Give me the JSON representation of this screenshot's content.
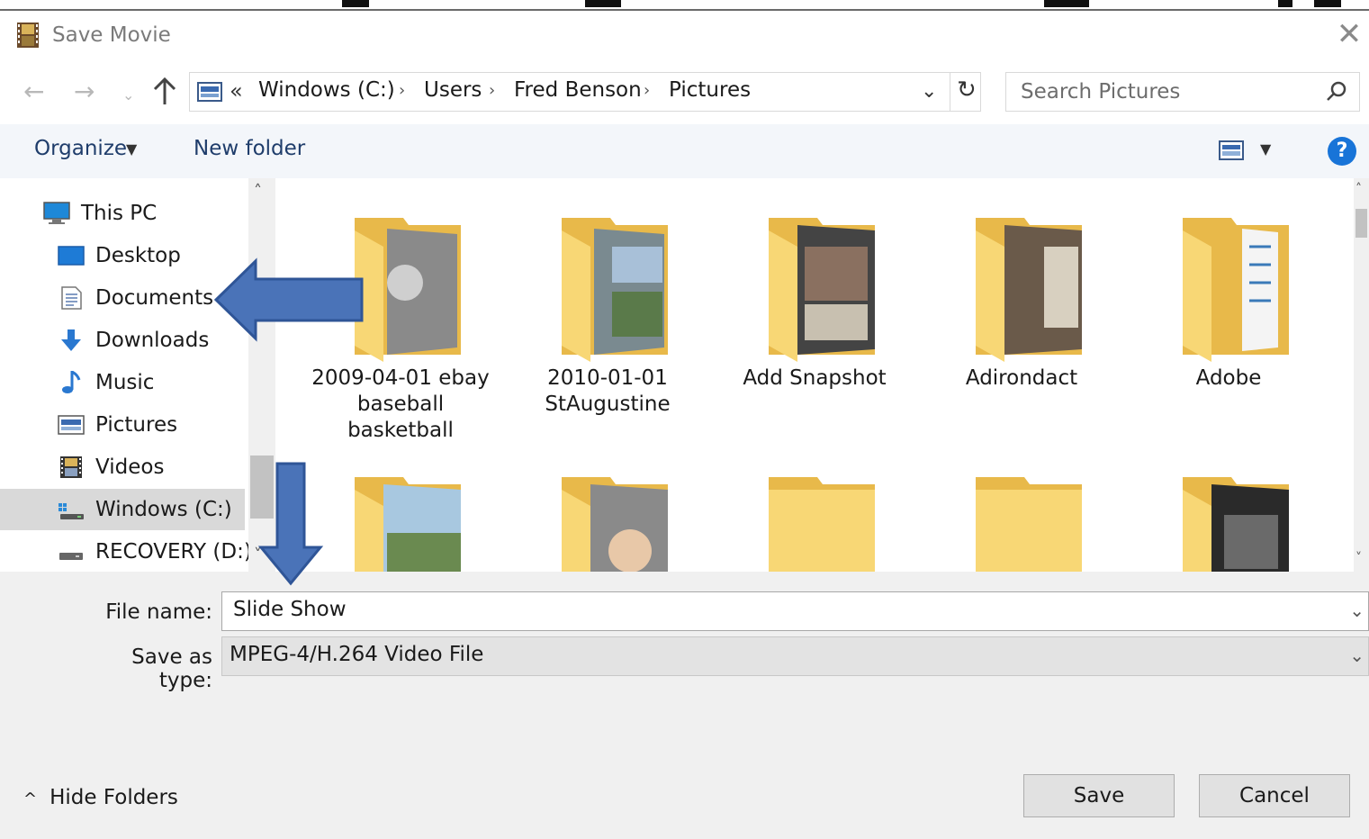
{
  "window": {
    "title": "Save Movie"
  },
  "address": {
    "chevron": "«",
    "crumbs": [
      "Windows (C:)",
      "Users",
      "Fred Benson",
      "Pictures"
    ],
    "separator": "›"
  },
  "search": {
    "placeholder": "Search Pictures"
  },
  "toolbar": {
    "organize": "Organize",
    "new_folder": "New folder",
    "help": "?"
  },
  "nav": {
    "items": [
      {
        "label": "This PC",
        "icon": "computer-icon"
      },
      {
        "label": "Desktop",
        "icon": "desktop-icon"
      },
      {
        "label": "Documents",
        "icon": "document-icon"
      },
      {
        "label": "Downloads",
        "icon": "download-icon"
      },
      {
        "label": "Music",
        "icon": "music-note-icon"
      },
      {
        "label": "Pictures",
        "icon": "pictures-icon"
      },
      {
        "label": "Videos",
        "icon": "film-icon"
      },
      {
        "label": "Windows (C:)",
        "icon": "drive-icon",
        "selected": true
      },
      {
        "label": "RECOVERY (D:)",
        "icon": "drive-icon"
      }
    ]
  },
  "folders": [
    {
      "label": "2009-04-01 ebay baseball basketball"
    },
    {
      "label": "2010-01-01 StAugustine"
    },
    {
      "label": "Add Snapshot"
    },
    {
      "label": "Adirondact"
    },
    {
      "label": "Adobe"
    },
    {
      "label": ""
    },
    {
      "label": ""
    },
    {
      "label": ""
    },
    {
      "label": ""
    },
    {
      "label": ""
    }
  ],
  "form": {
    "file_name_label": "File name:",
    "file_name_value": "Slide Show",
    "save_type_label": "Save as type:",
    "save_type_value": "MPEG-4/H.264 Video File"
  },
  "footer": {
    "hide_folders": "Hide Folders",
    "save": "Save",
    "cancel": "Cancel"
  },
  "colors": {
    "accent": "#1874d8",
    "folder": "#f8d775",
    "folder_dark": "#e8b94a",
    "annotation_arrow": "#4a73b8"
  }
}
